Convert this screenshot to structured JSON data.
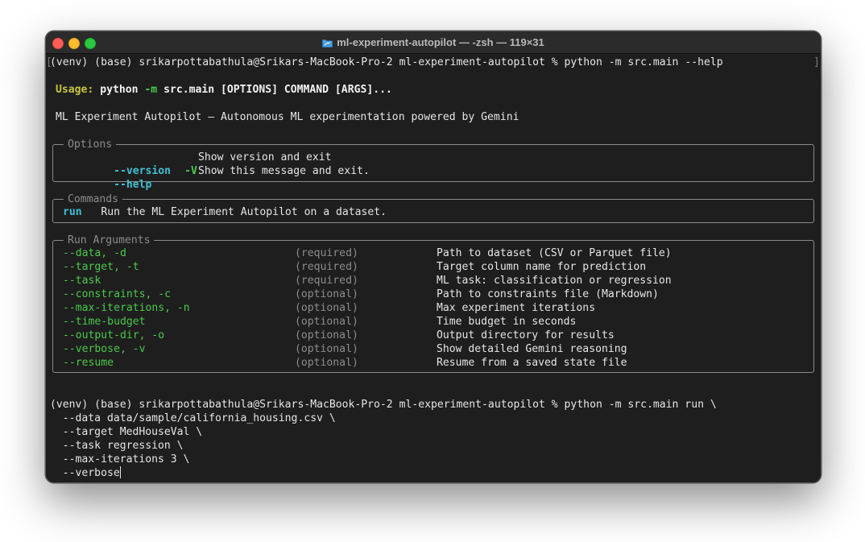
{
  "window": {
    "title": "ml-experiment-autopilot — -zsh — 119×31"
  },
  "first_prompt": {
    "prompt": "(venv) (base) srikarpottabathula@Srikars-MacBook-Pro-2 ml-experiment-autopilot % ",
    "command": "python -m src.main --help"
  },
  "usage": {
    "label": "Usage:",
    "python": "python",
    "flag": "-m",
    "rest": "src.main [OPTIONS] COMMAND [ARGS]..."
  },
  "description": "ML Experiment Autopilot — Autonomous ML experimentation powered by Gemini",
  "options_panel": {
    "title": "Options",
    "rows": [
      {
        "flag": "--version",
        "short": "-V",
        "desc": "Show version and exit"
      },
      {
        "flag": "--help",
        "short": "",
        "desc": "Show this message and exit."
      }
    ]
  },
  "commands_panel": {
    "title": "Commands",
    "rows": [
      {
        "name": "run",
        "desc": "Run the ML Experiment Autopilot on a dataset."
      }
    ]
  },
  "run_args_panel": {
    "title": "Run Arguments",
    "rows": [
      {
        "flag": "--data, -d",
        "req": "(required)",
        "desc": "Path to dataset (CSV or Parquet file)"
      },
      {
        "flag": "--target, -t",
        "req": "(required)",
        "desc": "Target column name for prediction"
      },
      {
        "flag": "--task",
        "req": "(required)",
        "desc": "ML task: classification or regression"
      },
      {
        "flag": "--constraints, -c",
        "req": "(optional)",
        "desc": "Path to constraints file (Markdown)"
      },
      {
        "flag": "--max-iterations, -n",
        "req": "(optional)",
        "desc": "Max experiment iterations"
      },
      {
        "flag": "--time-budget",
        "req": "(optional)",
        "desc": "Time budget in seconds"
      },
      {
        "flag": "--output-dir, -o",
        "req": "(optional)",
        "desc": "Output directory for results"
      },
      {
        "flag": "--verbose, -v",
        "req": "(optional)",
        "desc": "Show detailed Gemini reasoning"
      },
      {
        "flag": "--resume",
        "req": "(optional)",
        "desc": "Resume from a saved state file"
      }
    ]
  },
  "second_prompt": {
    "line1": "(venv) (base) srikarpottabathula@Srikars-MacBook-Pro-2 ml-experiment-autopilot % python -m src.main run \\",
    "continuations": [
      "  --data data/sample/california_housing.csv \\",
      "  --target MedHouseVal \\",
      "  --task regression \\",
      "  --max-iterations 3 \\",
      "  --verbose"
    ]
  },
  "icons": {
    "folder": "folder-icon",
    "cursor": "text-cursor"
  },
  "colors": {
    "background": "#1e1e1e",
    "usage_label": "#c7c43f",
    "flag_cyan": "#3fc1d3",
    "arg_green": "#4cc94c",
    "muted_gray": "#8d8d8d",
    "close": "#ff5f57",
    "minimize": "#febc2e",
    "maximize": "#28c840"
  }
}
